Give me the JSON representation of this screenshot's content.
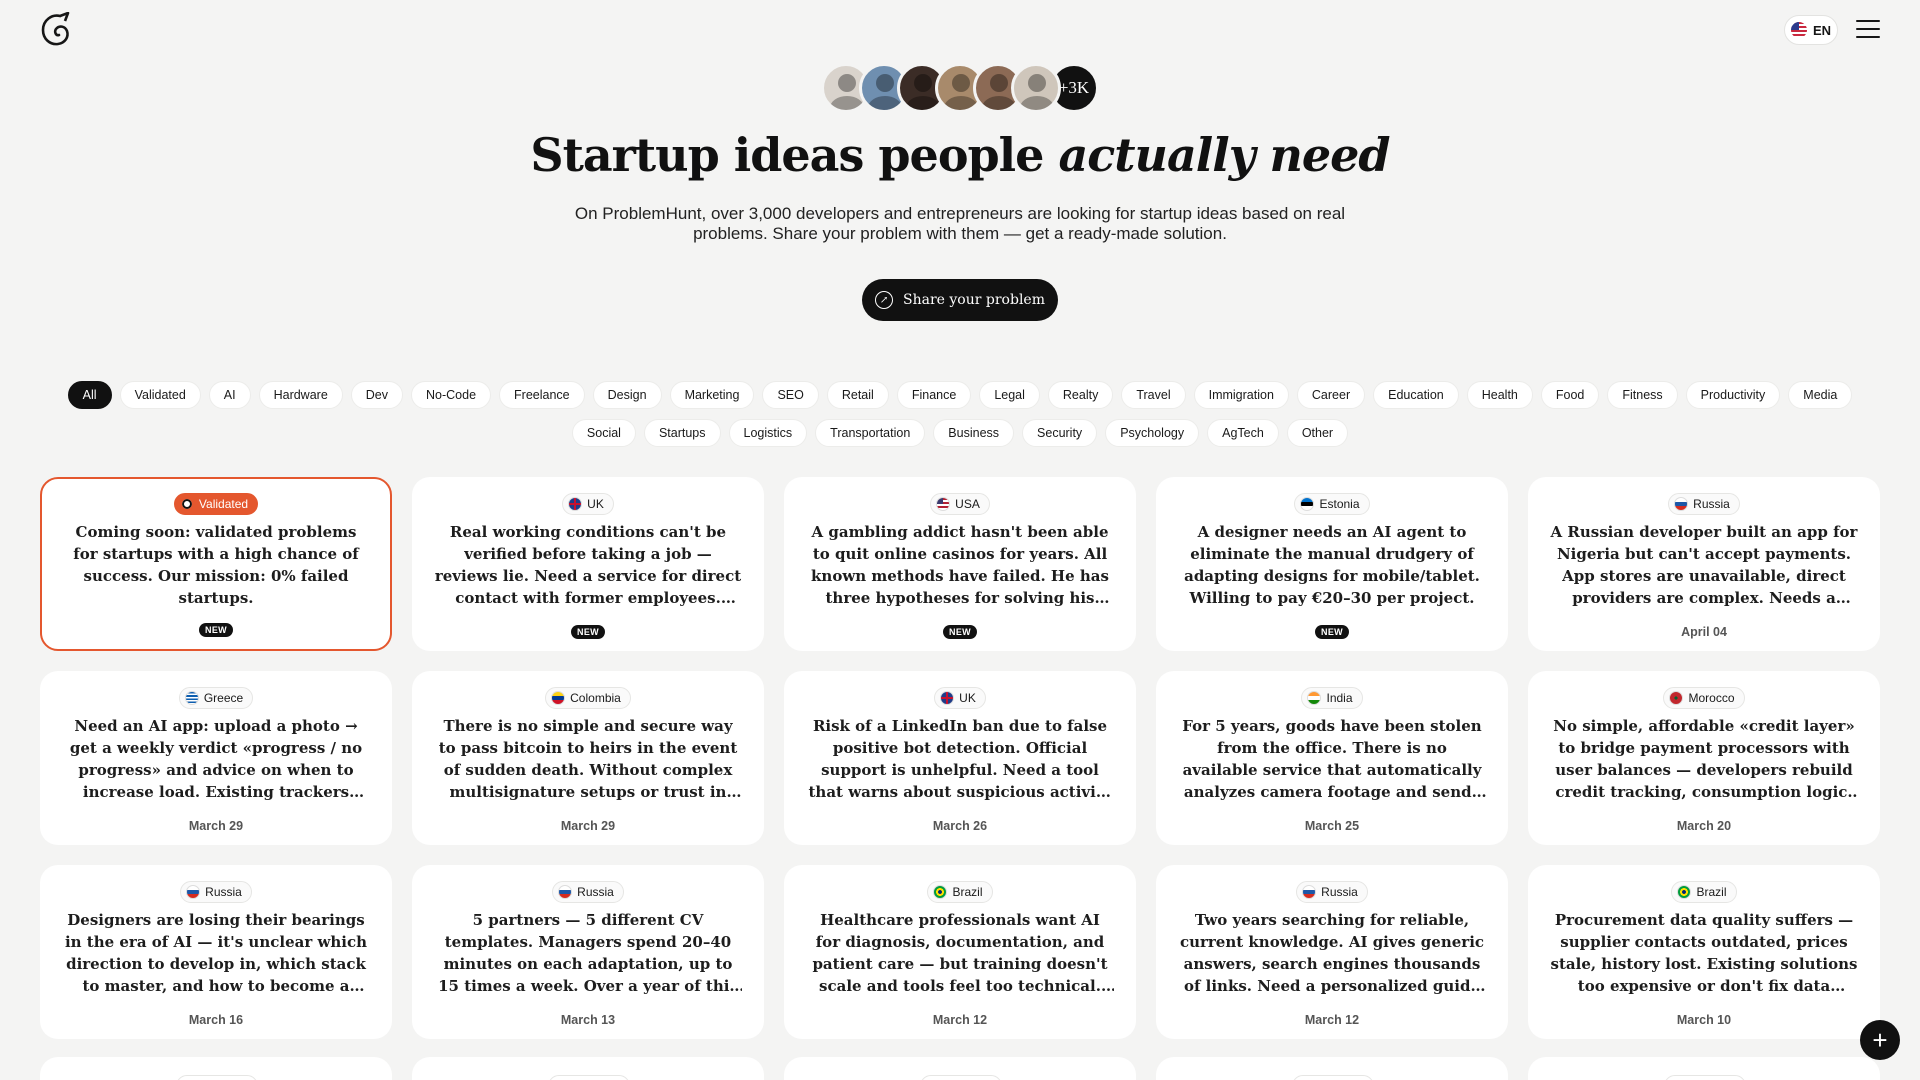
{
  "header": {
    "lang_label": "EN"
  },
  "hero": {
    "avatars_more": "+3K",
    "title_plain": "Startup ideas people ",
    "title_italic": "actually need",
    "subtitle": "On ProblemHunt, over 3,000 developers and entrepreneurs are looking for startup ideas based on real problems. Share your problem with them — get a ready-made solution.",
    "cta_label": "Share your problem"
  },
  "categories_row1": [
    "All",
    "Validated",
    "AI",
    "Hardware",
    "Dev",
    "No-Code",
    "Freelance",
    "Design",
    "Marketing",
    "SEO",
    "Retail",
    "Finance",
    "Legal",
    "Realty",
    "Travel",
    "Immigration",
    "Career",
    "Education",
    "Health",
    "Food",
    "Fitness",
    "Productivity",
    "Media"
  ],
  "categories_row2": [
    "Social",
    "Startups",
    "Logistics",
    "Transportation",
    "Business",
    "Security",
    "Psychology",
    "AgTech",
    "Other"
  ],
  "cards": [
    {
      "location": "Validated",
      "validated": true,
      "text": "Coming soon: validated problems for startups with a high chance of success. Our mission: 0% failed startups.",
      "footer": "NEW",
      "is_new": true
    },
    {
      "location": "UK",
      "text": "Real working conditions can't be verified before taking a job — reviews lie. Need a service for direct contact with former employees. Willing to pay…",
      "footer": "NEW",
      "is_new": true
    },
    {
      "location": "USA",
      "text": "A gambling addict hasn't been able to quit online casinos for years. All known methods have failed. He has three hypotheses for solving his own…",
      "footer": "NEW",
      "is_new": true
    },
    {
      "location": "Estonia",
      "text": "A designer needs an AI agent to eliminate the manual drudgery of adapting designs for mobile/tablet. Willing to pay €20–30 per project.",
      "footer": "NEW",
      "is_new": true
    },
    {
      "location": "Russia",
      "text": "A Russian developer built an app for Nigeria but can't accept payments. App stores are unavailable, direct providers are complex. Needs a simple solution…",
      "footer": "April 04"
    },
    {
      "location": "Greece",
      "text": "Need an AI app: upload a photo → get a weekly verdict «progress / no progress» and advice on when to increase load. Existing trackers either lack AI or are…",
      "footer": "March 29"
    },
    {
      "location": "Colombia",
      "text": "There is no simple and secure way to pass bitcoin to heirs in the event of sudden death. Without complex multisignature setups or trust in third…",
      "footer": "March 29"
    },
    {
      "location": "UK",
      "text": "Risk of a LinkedIn ban due to false positive bot detection. Official support is unhelpful. Need a tool that warns about suspicious activity to avoid losi…",
      "footer": "March 26"
    },
    {
      "location": "India",
      "text": "For 5 years, goods have been stolen from the office. There is no available service that automatically analyzes camera footage and sends alerts about…",
      "footer": "March 25"
    },
    {
      "location": "Morocco",
      "text": "No simple, affordable «credit layer» to bridge payment processors with user balances — developers rebuild credit tracking, consumption logic, and…",
      "footer": "March 20"
    },
    {
      "location": "Russia",
      "text": "Designers are losing their bearings in the era of AI — it's unclear which direction to develop in, which stack to master, and how to become a «highly…",
      "footer": "March 16"
    },
    {
      "location": "Russia",
      "text": "5 partners — 5 different CV templates. Managers spend 20–40 minutes on each adaptation, up to 15 times a week. Over a year of this routine. No ready-made…",
      "footer": "March 13"
    },
    {
      "location": "Brazil",
      "text": "Healthcare professionals want AI for diagnosis, documentation, and patient care — but training doesn't scale and tools feel too technical. Need a simple,…",
      "footer": "March 12"
    },
    {
      "location": "Russia",
      "text": "Two years searching for reliable, current knowledge. AI gives generic answers, search engines thousands of links. Need a personalized guide to…",
      "footer": "March 12"
    },
    {
      "location": "Brazil",
      "text": "Procurement data quality suffers — supplier contacts outdated, prices stale, history lost. Existing solutions too expensive or don't fix data quality. Nee…",
      "footer": "March 10"
    }
  ],
  "flag_colors": {
    "UK": [
      "#1f3c88",
      "#c8102e",
      "#ffffff"
    ],
    "USA": [
      "#b22234",
      "#ffffff",
      "#3c3b6e"
    ],
    "Estonia": [
      "#0072ce",
      "#000000",
      "#ffffff"
    ],
    "Russia": [
      "#ffffff",
      "#1c57a7",
      "#d52b1e"
    ],
    "Greece": [
      "#0d5eaf",
      "#ffffff",
      "#0d5eaf"
    ],
    "Colombia": [
      "#fcd116",
      "#003893",
      "#ce1126"
    ],
    "India": [
      "#ff9933",
      "#ffffff",
      "#138808"
    ],
    "Morocco": [
      "#c1272d",
      "#c1272d",
      "#006233"
    ],
    "Brazil": [
      "#009c3b",
      "#ffdf00",
      "#002776"
    ]
  },
  "accent_color": "#e4572e"
}
